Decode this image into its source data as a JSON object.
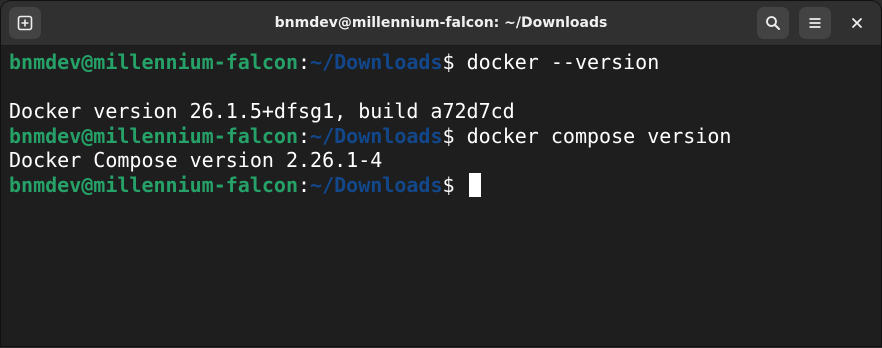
{
  "window": {
    "title": "bnmdev@millennium-falcon: ~/Downloads"
  },
  "titlebar": {
    "new_tab_icon": "plus-square-icon",
    "search_icon": "search-icon",
    "menu_icon": "hamburger-menu-icon",
    "close_icon": "close-icon"
  },
  "colors": {
    "user": "#26a269",
    "path": "#12488b",
    "text": "#ffffff",
    "background": "#1e1e1e"
  },
  "terminal": {
    "lines": [
      {
        "type": "prompt",
        "user": "bnmdev@millennium-falcon",
        "colon": ":",
        "path": "~/Downloads",
        "dollar": "$",
        "cmd": " docker --version"
      },
      {
        "type": "output",
        "text": ""
      },
      {
        "type": "output",
        "text": "Docker version 26.1.5+dfsg1, build a72d7cd"
      },
      {
        "type": "prompt",
        "user": "bnmdev@millennium-falcon",
        "colon": ":",
        "path": "~/Downloads",
        "dollar": "$",
        "cmd": " docker compose version"
      },
      {
        "type": "output",
        "text": "Docker Compose version 2.26.1-4"
      },
      {
        "type": "prompt",
        "user": "bnmdev@millennium-falcon",
        "colon": ":",
        "path": "~/Downloads",
        "dollar": "$",
        "cmd": " "
      }
    ]
  }
}
